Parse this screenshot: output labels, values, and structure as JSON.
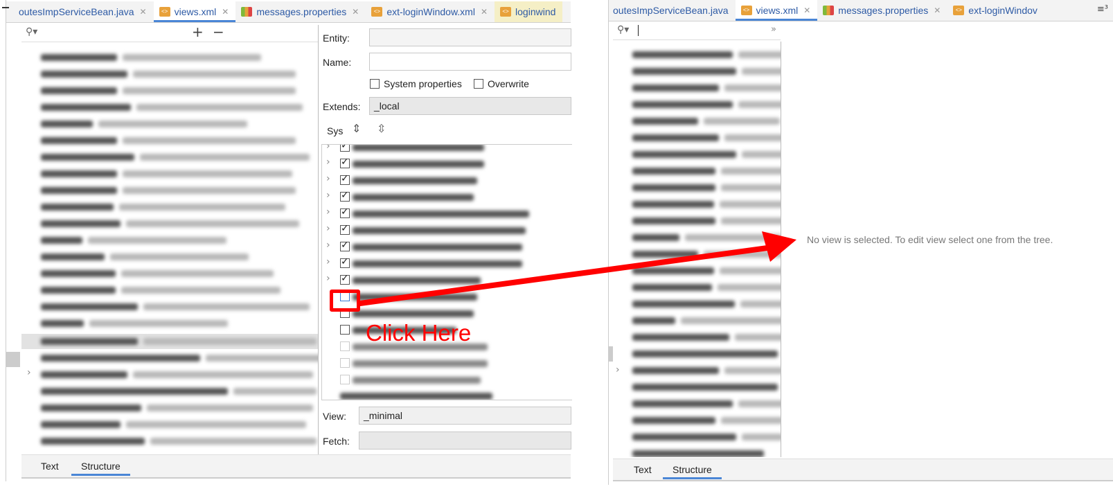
{
  "left": {
    "tabs": [
      {
        "label": "outesImpServiceBean.java",
        "icon": "java-file-icon"
      },
      {
        "label": "views.xml",
        "icon": "xml-file-icon"
      },
      {
        "label": "messages.properties",
        "icon": "properties-file-icon"
      },
      {
        "label": "ext-loginWindow.xml",
        "icon": "xml-file-icon"
      },
      {
        "label": "loginwind",
        "icon": "xml-file-icon"
      }
    ],
    "toolbar": {
      "add_label": "+",
      "remove_label": "−"
    },
    "form": {
      "entity_label": "Entity:",
      "name_label": "Name:",
      "system_properties_label": "System properties",
      "overwrite_label": "Overwrite",
      "extends_label": "Extends:",
      "extends_value": "_local",
      "sys_label": "Sys",
      "view_label": "View:",
      "view_value": "_minimal",
      "fetch_label": "Fetch:"
    },
    "bottom_tabs": {
      "text": "Text",
      "structure": "Structure"
    }
  },
  "annotation": {
    "click_here": "Click Here",
    "color": "#ff0000"
  },
  "right": {
    "tabs": [
      {
        "label": "outesImpServiceBean.java"
      },
      {
        "label": "views.xml"
      },
      {
        "label": "messages.properties"
      },
      {
        "label": "ext-loginWindov"
      }
    ],
    "overflow_label": "≡³",
    "collapse_label": "»",
    "empty_message": "No view is selected. To edit view select one from the tree.",
    "bottom_tabs": {
      "text": "Text",
      "structure": "Structure"
    }
  },
  "colors": {
    "accent": "#4a86d6",
    "tab_text": "#2d5aa5"
  }
}
